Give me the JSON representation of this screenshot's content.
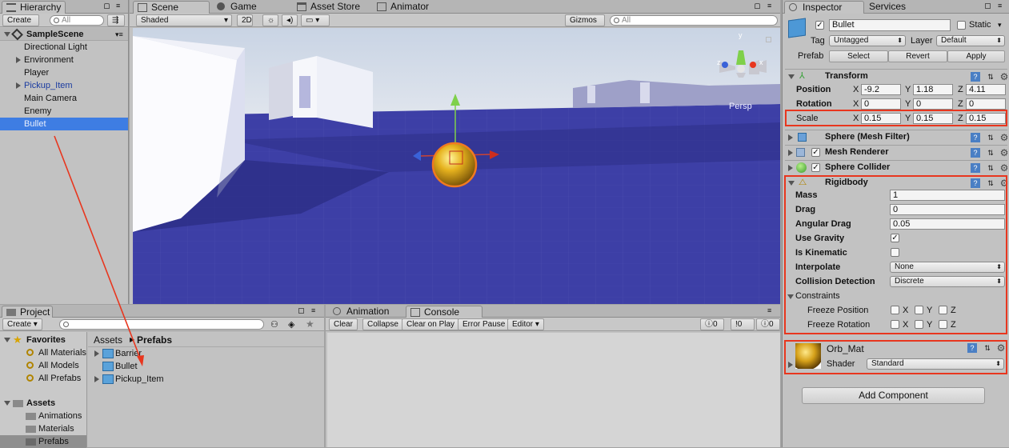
{
  "hierarchy": {
    "tab": "Hierarchy",
    "create": "Create",
    "search": "All",
    "scene": "SampleScene",
    "items": [
      "Directional Light",
      "Environment",
      "Player",
      "Pickup_Item",
      "Main Camera",
      "Enemy",
      "Bullet"
    ]
  },
  "scene": {
    "tabs": [
      "Scene",
      "Game",
      "Asset Store",
      "Animator"
    ],
    "shading": "Shaded",
    "mode2d": "2D",
    "gizmos": "Gizmos",
    "search": "All",
    "persp": "Persp",
    "gizmo_axes": {
      "x": "x",
      "y": "y",
      "z": "z"
    }
  },
  "project": {
    "tab": "Project",
    "create": "Create",
    "favorites": "Favorites",
    "fav_items": [
      "All Materials",
      "All Models",
      "All Prefabs"
    ],
    "assets": "Assets",
    "asset_folders": [
      "Animations",
      "Materials",
      "Prefabs"
    ],
    "breadcrumb": [
      "Assets",
      "Prefabs"
    ],
    "files": [
      "Barrier",
      "Bullet",
      "Pickup_Item"
    ]
  },
  "console": {
    "tabs": [
      "Animation",
      "Console"
    ],
    "buttons": [
      "Clear",
      "Collapse",
      "Clear on Play",
      "Error Pause",
      "Editor"
    ],
    "counts": [
      "0",
      "0",
      "0"
    ]
  },
  "inspector": {
    "tabs": [
      "Inspector",
      "Services"
    ],
    "name": "Bullet",
    "static": "Static",
    "tag_label": "Tag",
    "tag": "Untagged",
    "layer_label": "Layer",
    "layer": "Default",
    "prefab_label": "Prefab",
    "prefab_buttons": [
      "Select",
      "Revert",
      "Apply"
    ],
    "transform": {
      "title": "Transform",
      "position_label": "Position",
      "rotation_label": "Rotation",
      "scale_label": "Scale",
      "position": [
        "-9.2",
        "1.18",
        "4.11"
      ],
      "rotation": [
        "0",
        "0",
        "0"
      ],
      "scale": [
        "0.15",
        "0.15",
        "0.15"
      ],
      "axes": [
        "X",
        "Y",
        "Z"
      ]
    },
    "components": [
      "Sphere (Mesh Filter)",
      "Mesh Renderer",
      "Sphere Collider"
    ],
    "rigidbody": {
      "title": "Rigidbody",
      "mass_label": "Mass",
      "mass": "1",
      "drag_label": "Drag",
      "drag": "0",
      "angular_label": "Angular Drag",
      "angular": "0.05",
      "gravity_label": "Use Gravity",
      "kinematic_label": "Is Kinematic",
      "interp_label": "Interpolate",
      "interp": "None",
      "collision_label": "Collision Detection",
      "collision": "Discrete",
      "constraints_label": "Constraints",
      "freeze_pos": "Freeze Position",
      "freeze_rot": "Freeze Rotation"
    },
    "material": {
      "name": "Orb_Mat",
      "shader_label": "Shader",
      "shader": "Standard"
    },
    "add_component": "Add Component"
  },
  "colors": {
    "accent_red": "#e8361e",
    "selection": "#3e7de3",
    "floor": "#3d3fa6"
  }
}
